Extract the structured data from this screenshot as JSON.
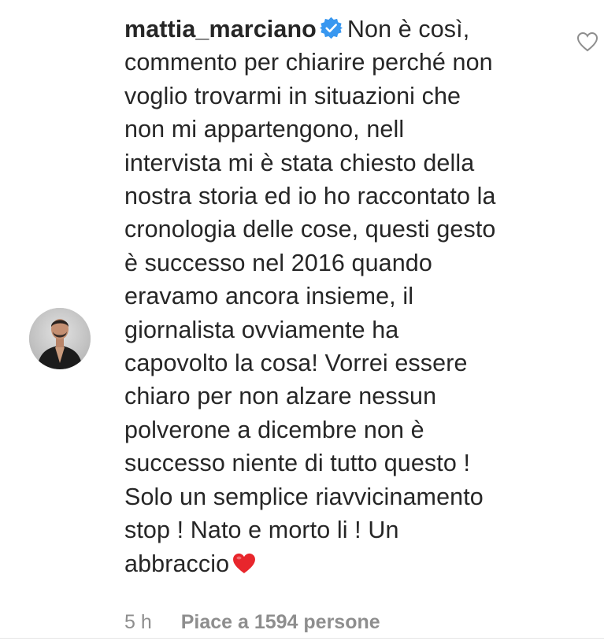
{
  "comment": {
    "username": "mattia_marciano",
    "text_lines": [
      "Non è così,",
      "commento per chiarire perché non",
      "voglio trovarmi in situazioni che",
      "non mi appartengono, nell",
      "intervista mi è stata chiesto della",
      "nostra storia ed io ho raccontato la",
      "cronologia delle cose, questi gesto",
      "è successo nel 2016 quando",
      "eravamo ancora insieme, il",
      "giornalista ovviamente ha",
      "capovolto la cosa! Vorrei essere",
      "chiaro per non alzare nessun",
      "polverone a dicembre non è",
      "successo niente di tutto questo !",
      "Solo un semplice riavvicinamento",
      "stop ! Nato e morto li ! Un",
      "abbraccio"
    ],
    "time": "5 h",
    "likes": "Piace a 1594 persone"
  },
  "icons": {
    "verified": "verified-badge-icon",
    "heart_emoji": "red-heart-emoji",
    "like": "heart-outline-icon"
  },
  "colors": {
    "verified_blue": "#3897f0",
    "heart_red": "#e8262c",
    "text": "#262626",
    "meta": "#8e8e8e"
  }
}
